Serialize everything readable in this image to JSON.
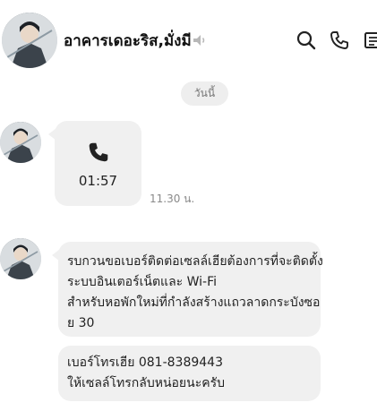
{
  "header": {
    "title": "อาคารเดอะริส,มั่งมี",
    "icons": [
      "search-icon",
      "phone-icon",
      "details-icon"
    ]
  },
  "date_separator": "วันนี้",
  "messages": [
    {
      "type": "call",
      "duration": "01:57",
      "time": "11.30 น."
    },
    {
      "type": "text",
      "lines": [
        "รบกวนขอเบอร์ติดต่อเซลล์เฮียต้องการที่จะติดตั้ง",
        "ระบบอินเตอร์เน็ตและ Wi-Fi",
        "สำหรับหอพักใหม่ที่กำลังสร้างแถวลาดกระบังซอ",
        "ย 30"
      ]
    },
    {
      "type": "text",
      "lines": [
        "เบอร์โทรเฮีย 081-8389443",
        "ให้เซลล์โทรกลับหน่อยนะครับ"
      ]
    }
  ],
  "colors": {
    "bubble": "#f0f0f0",
    "muted_text": "#8a8a8a"
  }
}
